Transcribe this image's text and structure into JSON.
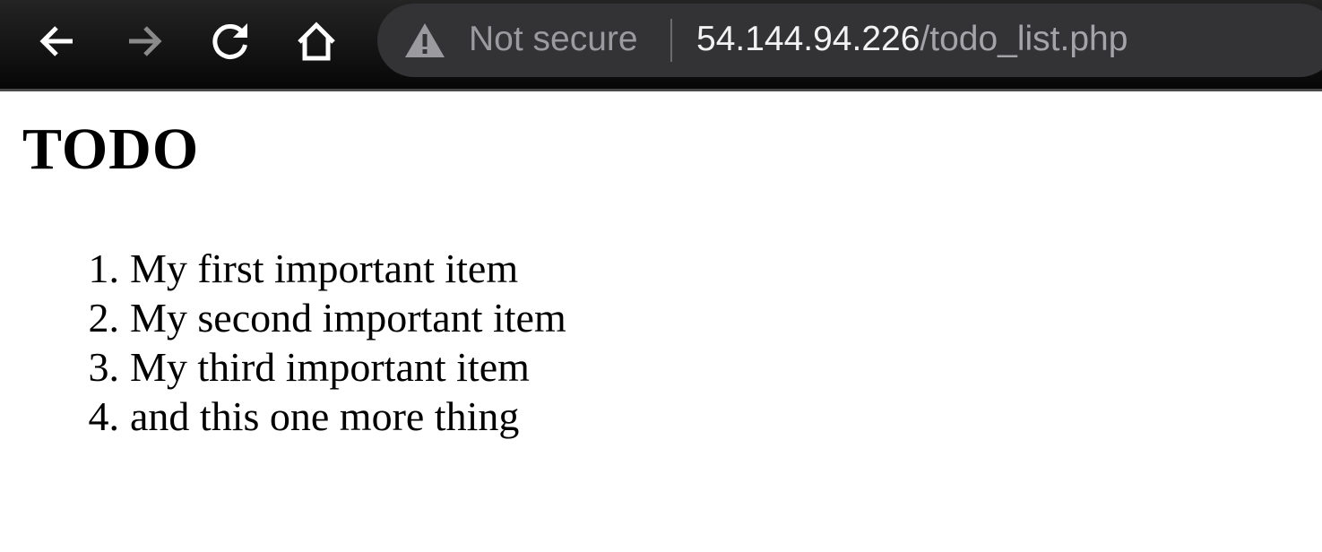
{
  "browser": {
    "security_label": "Not secure",
    "url_host": "54.144.94.226",
    "url_path": "/todo_list.php",
    "icons": {
      "back": "back-arrow-icon",
      "forward": "forward-arrow-icon",
      "reload": "reload-icon",
      "home": "home-icon",
      "security": "warning-triangle-icon"
    },
    "colors": {
      "toolbar": "#0c0c0c",
      "omnibox": "#333336",
      "enabled_icon": "#ffffff",
      "disabled_icon": "#8a8a8a"
    }
  },
  "page": {
    "title": "TODO",
    "items": [
      {
        "number": "1.",
        "text": "My first important item"
      },
      {
        "number": "2.",
        "text": "My second important item"
      },
      {
        "number": "3.",
        "text": "My third important item"
      },
      {
        "number": "4.",
        "text": "and this one more thing"
      }
    ]
  }
}
